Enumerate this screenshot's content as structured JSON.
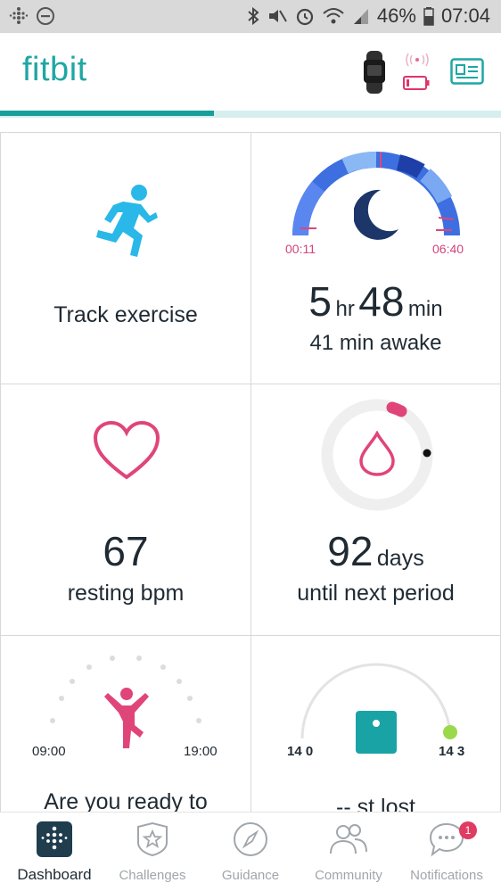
{
  "status_bar": {
    "battery_percent": "46%",
    "time": "07:04"
  },
  "app": {
    "logo": "fitbit"
  },
  "tiles": {
    "exercise": {
      "label": "Track exercise"
    },
    "sleep": {
      "start": "00:11",
      "end": "06:40",
      "hours": "5",
      "hours_unit": "hr",
      "minutes": "48",
      "minutes_unit": "min",
      "awake": "41 min awake"
    },
    "heart": {
      "value": "67",
      "label": "resting bpm"
    },
    "period": {
      "value": "92",
      "unit": "days",
      "label": "until next period"
    },
    "hourly": {
      "start": "09:00",
      "end": "19:00",
      "label": "Are you ready to"
    },
    "weight": {
      "left": "14 0",
      "right": "14 3",
      "label": "-- st lost"
    }
  },
  "nav": [
    {
      "label": "Dashboard"
    },
    {
      "label": "Challenges"
    },
    {
      "label": "Guidance"
    },
    {
      "label": "Community"
    },
    {
      "label": "Notifications",
      "badge": "1"
    }
  ]
}
